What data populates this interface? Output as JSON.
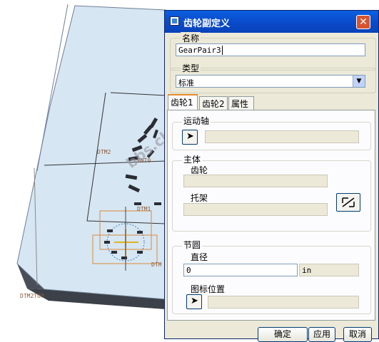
{
  "viewport": {
    "datum_labels": [
      "DTM2",
      "PNT0",
      "DTM1",
      "DTM2TOP",
      "DTM"
    ],
    "watermark": "bbs.chinade.net"
  },
  "dialog": {
    "title": "齿轮副定义",
    "close_glyph": "✕",
    "name_label": "名称",
    "name_value": "GearPair3",
    "type_label": "类型",
    "type_value": "标准",
    "tabs": [
      "齿轮1",
      "齿轮2",
      "属性"
    ],
    "motion_axis_label": "运动轴",
    "body_label": "主体",
    "body_sub_label": "齿轮",
    "bracket_label": "托架",
    "pitch_circle_label": "节圆",
    "diameter_label": "直径",
    "diameter_value": "0",
    "diameter_unit": "in",
    "icon_position_label": "图标位置",
    "ok_button": "确定",
    "apply_button": "应用",
    "cancel_button": "取消"
  },
  "colors": {
    "title_bar": "#0a49c8",
    "dialog_bg": "#ece9d8",
    "model_face": "#d7e6f3",
    "model_edge": "#3a3f4a"
  }
}
